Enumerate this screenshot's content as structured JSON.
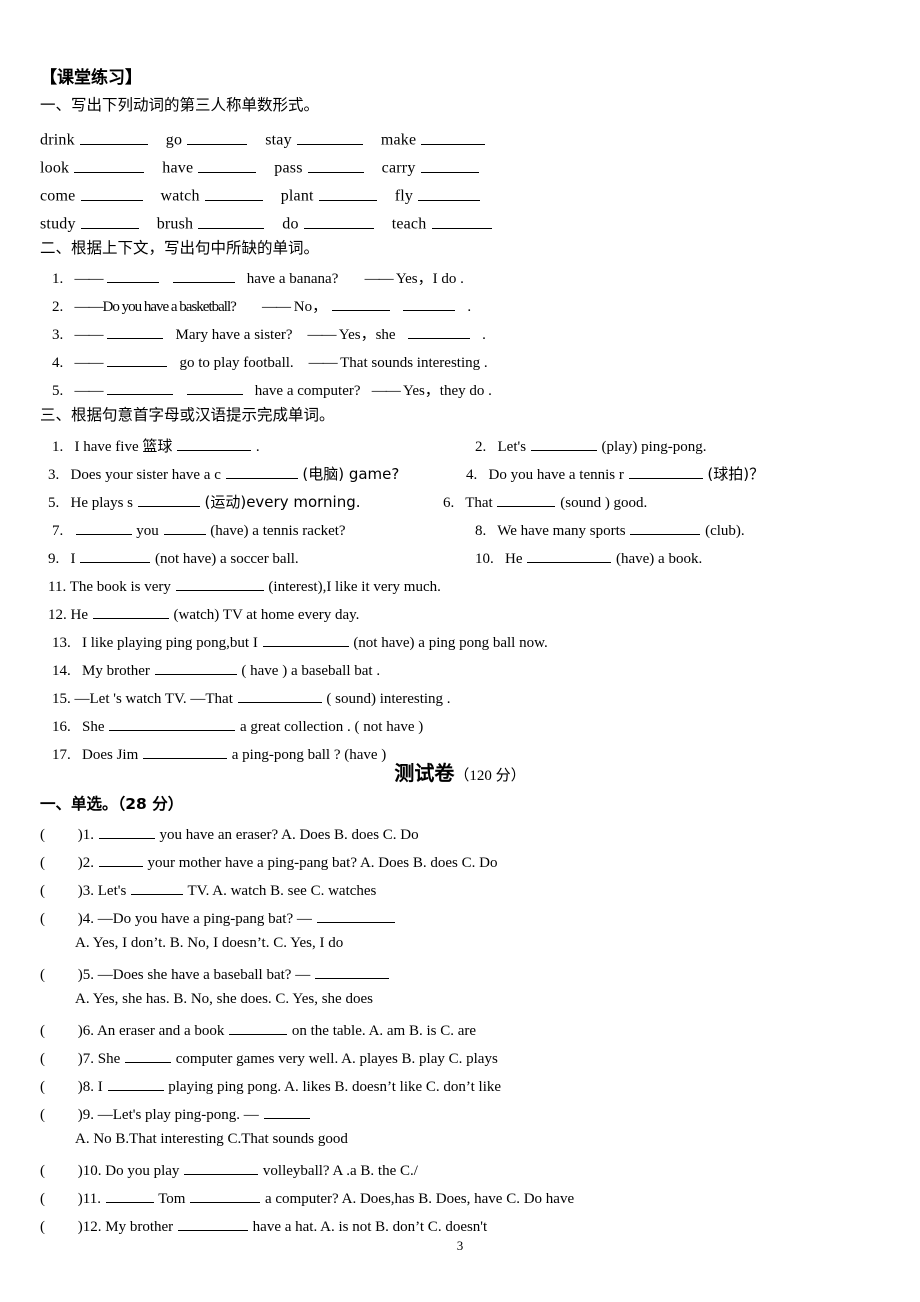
{
  "document": {
    "heading": "【课堂练习】",
    "page_number": "3"
  },
  "section_one": {
    "title": "一、写出下列动词的第三人称单数形式。",
    "rows": [
      [
        {
          "word": "drink",
          "gap": "  ",
          "blank": 68
        },
        {
          "word": "go",
          "gap": " ",
          "blank": 60
        },
        {
          "word": "stay",
          "gap": " ",
          "blank": 66
        },
        {
          "word": "make",
          "gap": " ",
          "blank": 64
        }
      ],
      [
        {
          "word": "look",
          "gap": "  ",
          "blank": 68
        },
        {
          "word": "have",
          "gap": "",
          "blank": 58
        },
        {
          "word": "pass",
          "gap": "",
          "blank": 56
        },
        {
          "word": "carry",
          "gap": " ",
          "blank": 58
        }
      ],
      [
        {
          "word": "come",
          "gap": "",
          "blank": 62
        },
        {
          "word": "watch",
          "gap": "",
          "blank": 58
        },
        {
          "word": "plant",
          "gap": "",
          "blank": 58
        },
        {
          "word": "fly",
          "gap": " ",
          "blank": 62
        }
      ],
      [
        {
          "word": "study",
          "gap": "",
          "blank": 58
        },
        {
          "word": "brush",
          "gap": "",
          "blank": 66
        },
        {
          "word": "do",
          "gap": "",
          "blank": 70
        },
        {
          "word": "teach",
          "gap": "",
          "blank": 60
        }
      ]
    ]
  },
  "section_two": {
    "title": "二、根据上下文，写出句中所缺的单词。",
    "items": [
      {
        "num": "1.",
        "pre_dash": "——",
        "blanks": [
          52,
          62
        ],
        "text_after": "have  a  banana?",
        "answer_dash": "——",
        "answer": "Yes，I  do ."
      },
      {
        "num": "2.",
        "question": "——Do  you  have  a  basketball?",
        "answer_dash": "——",
        "answer_pre": "No，",
        "answer_blanks": [
          58,
          52
        ],
        "answer_tail": "."
      },
      {
        "num": "3.",
        "pre_dash": "——",
        "blanks": [
          56
        ],
        "text_after": "Mary  have  a  sister?",
        "answer_dash": "——",
        "answer_pre": "Yes，she",
        "answer_blanks": [
          62
        ],
        "answer_tail": "."
      },
      {
        "num": "4.",
        "pre_dash": "——",
        "blanks": [
          60
        ],
        "text_after": "go  to  play  football.",
        "answer_dash": "——",
        "answer": "That  sounds  interesting ."
      },
      {
        "num": "5.",
        "pre_dash": "——",
        "blanks": [
          66,
          56
        ],
        "text_after": "have  a  computer?",
        "answer_dash": "——",
        "answer": "Yes，they  do ."
      }
    ]
  },
  "section_three": {
    "title": "三、根据句意首字母或汉语提示完成单词。",
    "items": [
      {
        "num": "1.",
        "a": "I have five  篮球 ",
        "blank": 74,
        "b": "."
      },
      {
        "num": "2.",
        "a": "Let's",
        "blank": 66,
        "b": "(play) ping-pong."
      },
      {
        "num": "3.",
        "a": "Does your sister have a c",
        "blank": 72,
        "b": "(电脑) game?"
      },
      {
        "num": "4.",
        "a": "Do you have a tennis r ",
        "blank": 74,
        "b": "(球拍)？"
      },
      {
        "num": "5.",
        "a": "He plays s",
        "blank": 62,
        "b": "(运动)every morning."
      },
      {
        "num": "6.",
        "a": "That ",
        "blank": 58,
        "b": " (sound ) good."
      },
      {
        "num": "7.",
        "a": "",
        "blank": 56,
        "a2": " you ",
        "blank2": 42,
        "b": " (have) a tennis racket?"
      },
      {
        "num": "8.",
        "a": "We have many sports ",
        "blank": 70,
        "b": "(club)."
      },
      {
        "num": "9.",
        "a": "I ",
        "blank": 70,
        "b": "(not have) a soccer ball."
      },
      {
        "num": "10.",
        "a": "He ",
        "blank": 84,
        "b": " (have) a book."
      },
      {
        "num": "11.",
        "a": "The book is very",
        "blank": 88,
        "b": "(interest),I like it very much."
      },
      {
        "num": "12.",
        "a": "He",
        "blank": 76,
        "b": "(watch) TV at home every day."
      },
      {
        "num": "13.",
        "a": "I like playing ping pong,but I",
        "blank": 86,
        "b": "(not have) a ping pong ball now."
      },
      {
        "num": "14.",
        "a": "My brother ",
        "blank": 82,
        "b": " ( have ) a baseball bat ."
      },
      {
        "num": "15.",
        "a": "—Let 's watch TV.",
        "mid": "    —That ",
        "blank": 84,
        "b": "( sound) interesting ."
      },
      {
        "num": "16.",
        "a": "She ",
        "blank": 126,
        "b": " a great collection . ( not have )"
      },
      {
        "num": "17.",
        "a": "Does Jim ",
        "blank": 84,
        "b": " a ping-pong ball ? (have )"
      }
    ]
  },
  "exam": {
    "title": "测试卷",
    "score": "（120 分）",
    "part_one": {
      "title_cn": "一、单选。",
      "title_score": "（28 分）",
      "questions": [
        {
          "num": ")1.",
          "blank": 56,
          "stem": "you have an eraser?",
          "options": "A. Does     B. does     C. Do",
          "stem_gap": "        "
        },
        {
          "num": ")2.",
          "blank": 44,
          "stem": "your mother have a ping-pang bat?",
          "options": "A. Does     B. does     C. Do",
          "stem_gap": "         "
        },
        {
          "num": ")3.",
          "pre": " Let's",
          "blank": 52,
          "stem": "TV.",
          "options": "A. watch          B. see      C. watches",
          "stem_gap": "    "
        },
        {
          "num": ")4.",
          "pre": "—Do you have a ping-pang bat?",
          "mid": "     —  ",
          "blank": 78,
          "options_line": "A. Yes, I don’t.     B. No, I doesn’t.     C. Yes, I do"
        },
        {
          "num": ")5.",
          "pre": "—Does she have a baseball bat?",
          "mid": "     —  ",
          "blank": 74,
          "options_line": "A. Yes, she has.       B. No, she does.     C. Yes, she does"
        },
        {
          "num": ")6.",
          "pre": " An eraser and a book ",
          "blank": 58,
          "stem": " on the table.",
          "options": "A. am             B. is            C. are",
          "stem_gap": "   "
        },
        {
          "num": ")7.",
          "pre": " She",
          "blank": 46,
          "stem": " computer games very well.",
          "options": "A. playes          B. play   C. plays",
          "stem_gap": "    "
        },
        {
          "num": ")8.",
          "pre": " I",
          "blank": 56,
          "stem": "playing ping pong.",
          "options": "A. likes   B. doesn’t like     C. don’t like",
          "stem_gap": "       "
        },
        {
          "num": ")9.",
          "pre": "—Let's play ping-pong.",
          "mid": "      —",
          "blank": 46,
          "options_line": "A. No       B.That interesting        C.That sounds good"
        },
        {
          "num": ")10.",
          "pre": " Do you play ",
          "blank": 74,
          "stem": " volleyball?",
          "options": "A .a      B. the      C./",
          "stem_gap": "        "
        },
        {
          "num": ")11.",
          "pre": " ",
          "blank": 48,
          "stem2": " Tom ",
          "blank2": 70,
          "stem": "a computer?",
          "options": "A. Does,has     B. Does, have     C. Do have",
          "stem_gap": "      "
        },
        {
          "num": ")12.",
          "pre": "My brother",
          "blank": 70,
          "stem": " have a hat.",
          "options": "A. is not        B. don’t       C. doesn't",
          "stem_gap": "      "
        }
      ]
    }
  }
}
